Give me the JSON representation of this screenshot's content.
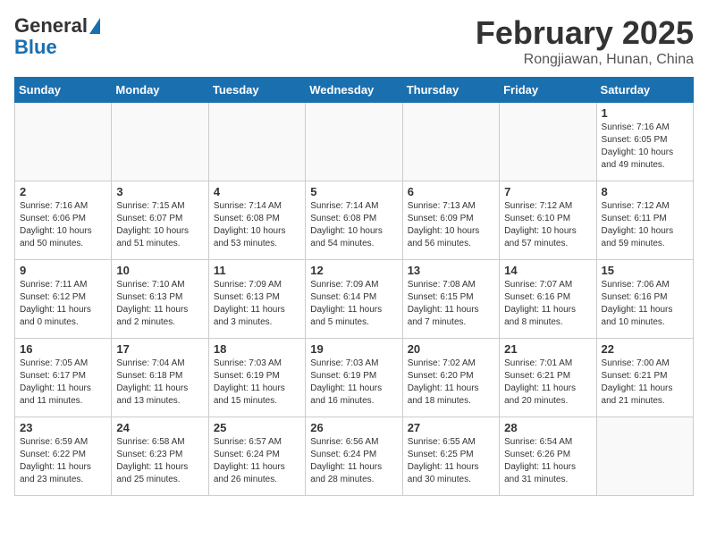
{
  "header": {
    "logo_general": "General",
    "logo_blue": "Blue",
    "title": "February 2025",
    "subtitle": "Rongjiawan, Hunan, China"
  },
  "weekdays": [
    "Sunday",
    "Monday",
    "Tuesday",
    "Wednesday",
    "Thursday",
    "Friday",
    "Saturday"
  ],
  "weeks": [
    [
      {
        "day": "",
        "info": ""
      },
      {
        "day": "",
        "info": ""
      },
      {
        "day": "",
        "info": ""
      },
      {
        "day": "",
        "info": ""
      },
      {
        "day": "",
        "info": ""
      },
      {
        "day": "",
        "info": ""
      },
      {
        "day": "1",
        "info": "Sunrise: 7:16 AM\nSunset: 6:05 PM\nDaylight: 10 hours\nand 49 minutes."
      }
    ],
    [
      {
        "day": "2",
        "info": "Sunrise: 7:16 AM\nSunset: 6:06 PM\nDaylight: 10 hours\nand 50 minutes."
      },
      {
        "day": "3",
        "info": "Sunrise: 7:15 AM\nSunset: 6:07 PM\nDaylight: 10 hours\nand 51 minutes."
      },
      {
        "day": "4",
        "info": "Sunrise: 7:14 AM\nSunset: 6:08 PM\nDaylight: 10 hours\nand 53 minutes."
      },
      {
        "day": "5",
        "info": "Sunrise: 7:14 AM\nSunset: 6:08 PM\nDaylight: 10 hours\nand 54 minutes."
      },
      {
        "day": "6",
        "info": "Sunrise: 7:13 AM\nSunset: 6:09 PM\nDaylight: 10 hours\nand 56 minutes."
      },
      {
        "day": "7",
        "info": "Sunrise: 7:12 AM\nSunset: 6:10 PM\nDaylight: 10 hours\nand 57 minutes."
      },
      {
        "day": "8",
        "info": "Sunrise: 7:12 AM\nSunset: 6:11 PM\nDaylight: 10 hours\nand 59 minutes."
      }
    ],
    [
      {
        "day": "9",
        "info": "Sunrise: 7:11 AM\nSunset: 6:12 PM\nDaylight: 11 hours\nand 0 minutes."
      },
      {
        "day": "10",
        "info": "Sunrise: 7:10 AM\nSunset: 6:13 PM\nDaylight: 11 hours\nand 2 minutes."
      },
      {
        "day": "11",
        "info": "Sunrise: 7:09 AM\nSunset: 6:13 PM\nDaylight: 11 hours\nand 3 minutes."
      },
      {
        "day": "12",
        "info": "Sunrise: 7:09 AM\nSunset: 6:14 PM\nDaylight: 11 hours\nand 5 minutes."
      },
      {
        "day": "13",
        "info": "Sunrise: 7:08 AM\nSunset: 6:15 PM\nDaylight: 11 hours\nand 7 minutes."
      },
      {
        "day": "14",
        "info": "Sunrise: 7:07 AM\nSunset: 6:16 PM\nDaylight: 11 hours\nand 8 minutes."
      },
      {
        "day": "15",
        "info": "Sunrise: 7:06 AM\nSunset: 6:16 PM\nDaylight: 11 hours\nand 10 minutes."
      }
    ],
    [
      {
        "day": "16",
        "info": "Sunrise: 7:05 AM\nSunset: 6:17 PM\nDaylight: 11 hours\nand 11 minutes."
      },
      {
        "day": "17",
        "info": "Sunrise: 7:04 AM\nSunset: 6:18 PM\nDaylight: 11 hours\nand 13 minutes."
      },
      {
        "day": "18",
        "info": "Sunrise: 7:03 AM\nSunset: 6:19 PM\nDaylight: 11 hours\nand 15 minutes."
      },
      {
        "day": "19",
        "info": "Sunrise: 7:03 AM\nSunset: 6:19 PM\nDaylight: 11 hours\nand 16 minutes."
      },
      {
        "day": "20",
        "info": "Sunrise: 7:02 AM\nSunset: 6:20 PM\nDaylight: 11 hours\nand 18 minutes."
      },
      {
        "day": "21",
        "info": "Sunrise: 7:01 AM\nSunset: 6:21 PM\nDaylight: 11 hours\nand 20 minutes."
      },
      {
        "day": "22",
        "info": "Sunrise: 7:00 AM\nSunset: 6:21 PM\nDaylight: 11 hours\nand 21 minutes."
      }
    ],
    [
      {
        "day": "23",
        "info": "Sunrise: 6:59 AM\nSunset: 6:22 PM\nDaylight: 11 hours\nand 23 minutes."
      },
      {
        "day": "24",
        "info": "Sunrise: 6:58 AM\nSunset: 6:23 PM\nDaylight: 11 hours\nand 25 minutes."
      },
      {
        "day": "25",
        "info": "Sunrise: 6:57 AM\nSunset: 6:24 PM\nDaylight: 11 hours\nand 26 minutes."
      },
      {
        "day": "26",
        "info": "Sunrise: 6:56 AM\nSunset: 6:24 PM\nDaylight: 11 hours\nand 28 minutes."
      },
      {
        "day": "27",
        "info": "Sunrise: 6:55 AM\nSunset: 6:25 PM\nDaylight: 11 hours\nand 30 minutes."
      },
      {
        "day": "28",
        "info": "Sunrise: 6:54 AM\nSunset: 6:26 PM\nDaylight: 11 hours\nand 31 minutes."
      },
      {
        "day": "",
        "info": ""
      }
    ]
  ]
}
